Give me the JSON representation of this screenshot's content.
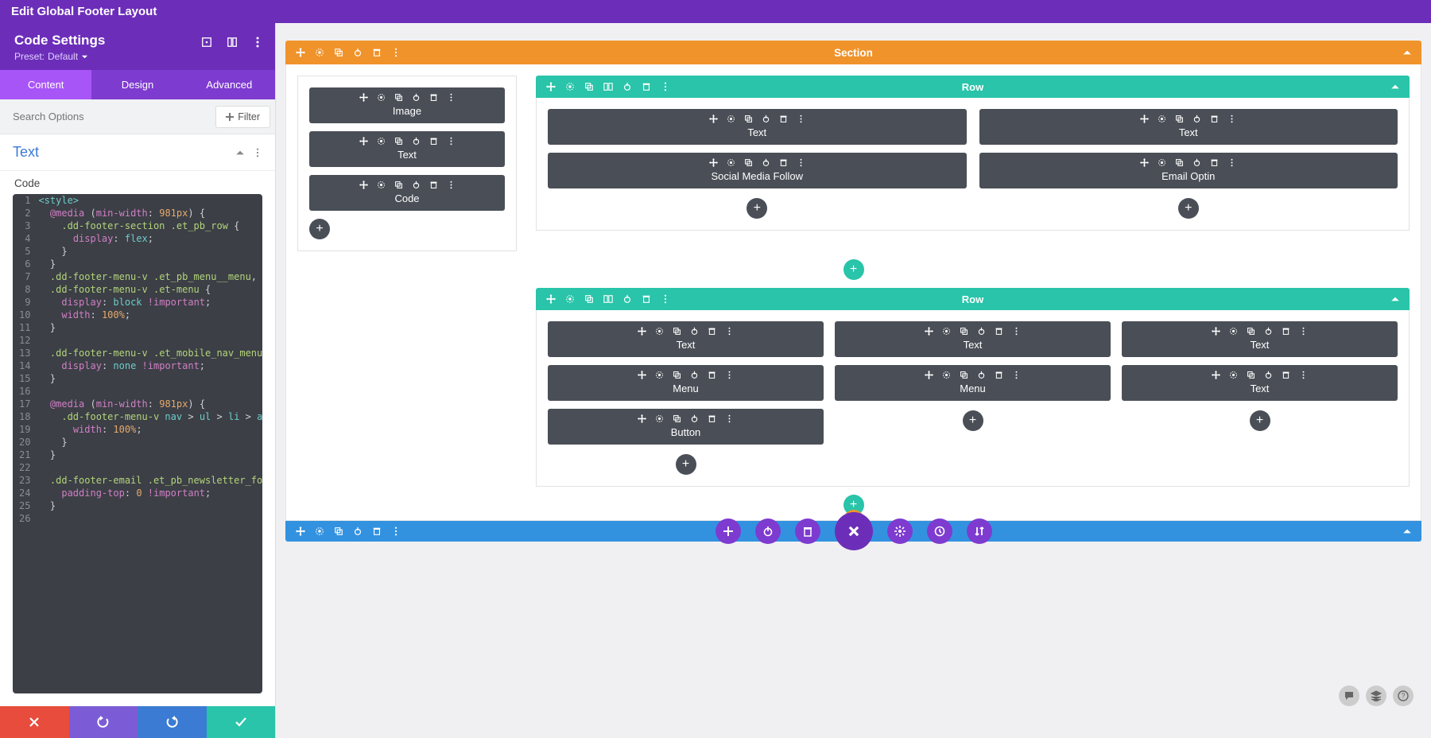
{
  "topbar": {
    "title": "Edit Global Footer Layout"
  },
  "sidebar": {
    "title": "Code Settings",
    "preset_label": "Preset:",
    "preset_value": "Default"
  },
  "tabs": [
    {
      "label": "Content",
      "active": true
    },
    {
      "label": "Design",
      "active": false
    },
    {
      "label": "Advanced",
      "active": false
    }
  ],
  "search": {
    "placeholder": "Search Options",
    "filter_label": "Filter"
  },
  "accordion": {
    "title": "Text",
    "sublabel": "Code"
  },
  "code_lines": [
    {
      "n": "1",
      "html": "<span class='tok-tag'>&lt;style&gt;</span>"
    },
    {
      "n": "2",
      "html": "  <span class='tok-at'>@media</span> <span class='tok-paren'>(</span><span class='tok-prop'>min-width</span><span class='tok-paren'>:</span> <span class='tok-num'>981px</span><span class='tok-paren'>)</span> <span class='tok-brace'>{</span>"
    },
    {
      "n": "3",
      "html": "    <span class='tok-sel'>.dd-footer-section</span> <span class='tok-sel'>.et_pb_row</span> <span class='tok-brace'>{</span>"
    },
    {
      "n": "4",
      "html": "      <span class='tok-prop'>display</span><span class='tok-paren'>:</span> <span class='tok-val'>flex</span><span class='tok-paren'>;</span>"
    },
    {
      "n": "5",
      "html": "    <span class='tok-brace'>}</span>"
    },
    {
      "n": "6",
      "html": "  <span class='tok-brace'>}</span>"
    },
    {
      "n": "7",
      "html": "  <span class='tok-sel'>.dd-footer-menu-v</span> <span class='tok-sel'>.et_pb_menu__menu</span><span class='tok-paren'>,</span>"
    },
    {
      "n": "8",
      "html": "  <span class='tok-sel'>.dd-footer-menu-v</span> <span class='tok-sel'>.et-menu</span> <span class='tok-brace'>{</span>"
    },
    {
      "n": "9",
      "html": "    <span class='tok-prop'>display</span><span class='tok-paren'>:</span> <span class='tok-val'>block</span> <span class='tok-imp'>!important</span><span class='tok-paren'>;</span>"
    },
    {
      "n": "10",
      "html": "    <span class='tok-prop'>width</span><span class='tok-paren'>:</span> <span class='tok-num'>100%</span><span class='tok-paren'>;</span>"
    },
    {
      "n": "11",
      "html": "  <span class='tok-brace'>}</span>"
    },
    {
      "n": "12",
      "html": ""
    },
    {
      "n": "13",
      "html": "  <span class='tok-sel'>.dd-footer-menu-v</span> <span class='tok-sel'>.et_mobile_nav_menu</span> <span class='tok-brace'>{</span>"
    },
    {
      "n": "14",
      "html": "    <span class='tok-prop'>display</span><span class='tok-paren'>:</span> <span class='tok-val'>none</span> <span class='tok-imp'>!important</span><span class='tok-paren'>;</span>"
    },
    {
      "n": "15",
      "html": "  <span class='tok-brace'>}</span>"
    },
    {
      "n": "16",
      "html": ""
    },
    {
      "n": "17",
      "html": "  <span class='tok-at'>@media</span> <span class='tok-paren'>(</span><span class='tok-prop'>min-width</span><span class='tok-paren'>:</span> <span class='tok-num'>981px</span><span class='tok-paren'>)</span> <span class='tok-brace'>{</span>"
    },
    {
      "n": "18",
      "html": "    <span class='tok-sel'>.dd-footer-menu-v</span> <span class='tok-val'>nav</span> <span class='tok-paren'>&gt;</span> <span class='tok-val'>ul</span> <span class='tok-paren'>&gt;</span> <span class='tok-val'>li</span> <span class='tok-paren'>&gt;</span> <span class='tok-val'>a</span> <span class='tok-brace'>{</span>"
    },
    {
      "n": "19",
      "html": "      <span class='tok-prop'>width</span><span class='tok-paren'>:</span> <span class='tok-num'>100%</span><span class='tok-paren'>;</span>"
    },
    {
      "n": "20",
      "html": "    <span class='tok-brace'>}</span>"
    },
    {
      "n": "21",
      "html": "  <span class='tok-brace'>}</span>"
    },
    {
      "n": "22",
      "html": ""
    },
    {
      "n": "23",
      "html": "  <span class='tok-sel'>.dd-footer-email</span> <span class='tok-sel'>.et_pb_newsletter_form</span> <span class='tok-brace'>{</span>"
    },
    {
      "n": "24",
      "html": "    <span class='tok-prop'>padding-top</span><span class='tok-paren'>:</span> <span class='tok-num'>0</span> <span class='tok-imp'>!important</span><span class='tok-paren'>;</span>"
    },
    {
      "n": "25",
      "html": "  <span class='tok-brace'>}</span>"
    },
    {
      "n": "26",
      "html": ""
    }
  ],
  "section": {
    "label": "Section"
  },
  "left_modules": [
    "Image",
    "Text",
    "Code"
  ],
  "row_label": "Row",
  "row1_cols": [
    [
      "Text",
      "Social Media Follow"
    ],
    [
      "Text",
      "Email Optin"
    ]
  ],
  "row2_cols": [
    [
      "Text",
      "Menu",
      "Button"
    ],
    [
      "Text",
      "Menu"
    ],
    [
      "Text",
      "Text"
    ]
  ],
  "plus": "+"
}
